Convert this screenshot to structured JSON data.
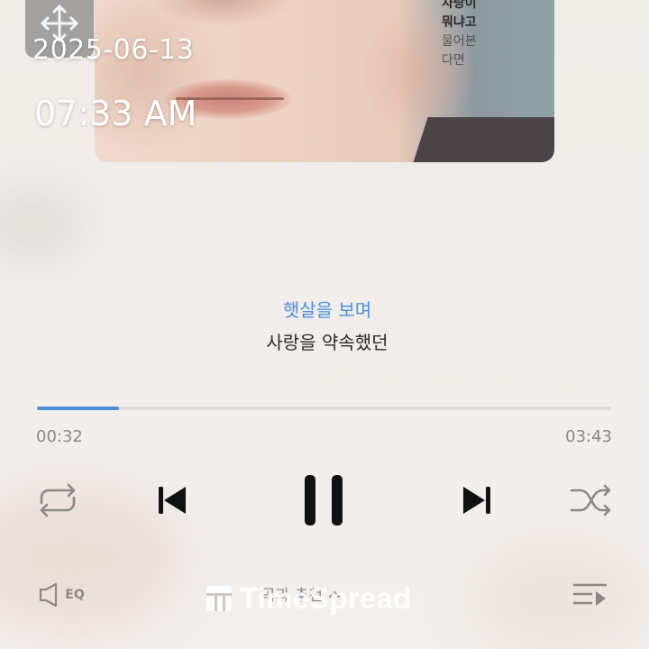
{
  "album_art": {
    "caption_lines": [
      "사랑이",
      "뭐냐고",
      "물어본",
      "다면"
    ]
  },
  "timestamp": {
    "date": "2025-06-13",
    "time": "07:33 AM"
  },
  "lyrics": {
    "current": "햇살을 보며",
    "next": "사랑을 약속했던"
  },
  "progress": {
    "elapsed": "00:32",
    "total": "03:43",
    "fraction": 0.143
  },
  "controls": {
    "repeat_icon": "repeat-icon",
    "prev_icon": "skip-previous-icon",
    "play_state": "playing",
    "pause_icon": "pause-icon",
    "next_icon": "skip-next-icon",
    "shuffle_icon": "shuffle-icon"
  },
  "bottom_bar": {
    "eq_label": "EQ",
    "recommend_label": "곡과 추천",
    "playlist_icon": "playlist-icon"
  },
  "watermark": {
    "text": "TimeSpread"
  },
  "colors": {
    "accent": "#4a8fdc",
    "icon_dark": "#111111",
    "icon_gray": "#8b8886",
    "track": "#dedbd8"
  }
}
